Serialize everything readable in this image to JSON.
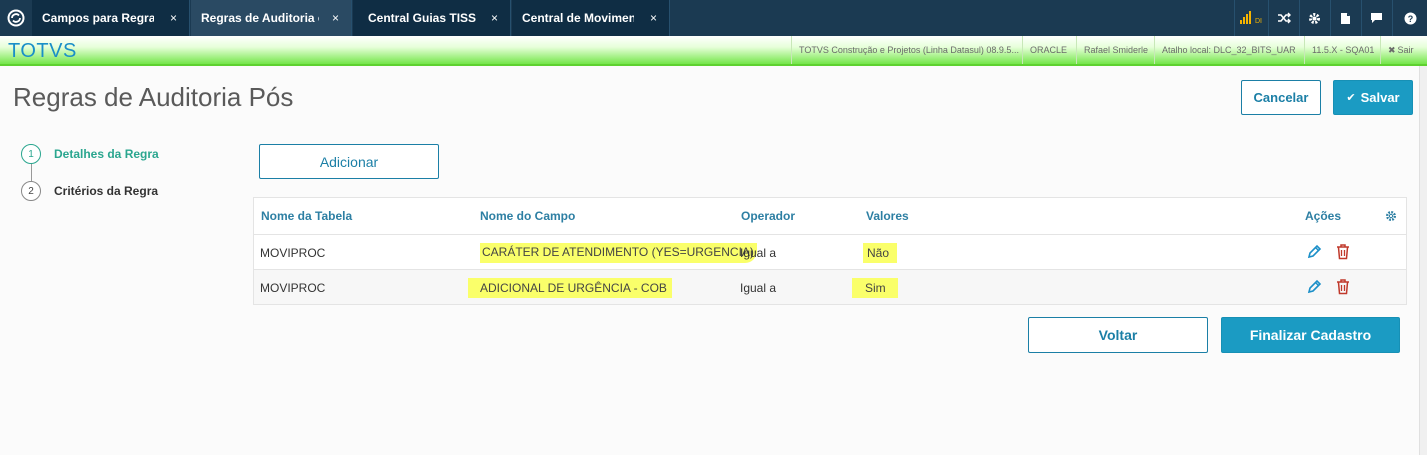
{
  "tabs": [
    {
      "label": "Campos para Regras de Auditoria",
      "close": "×"
    },
    {
      "label": "Regras de Auditoria e Pós",
      "close": "×"
    },
    {
      "label": "Central Guias TISS",
      "close": "×"
    },
    {
      "label": "Central de Movimentação",
      "close": "×"
    }
  ],
  "topbar_icons": [
    {
      "icon": "signal-icon",
      "text": "DI"
    },
    {
      "icon": "shuffle-icon"
    },
    {
      "icon": "gear-icon"
    },
    {
      "icon": "document-icon"
    },
    {
      "icon": "chat-icon"
    },
    {
      "icon": "help-icon"
    }
  ],
  "brand": "TOTVS",
  "info_bar": {
    "company": "TOTVS Construção e Projetos (Linha Datasul) 08.9.5...",
    "database": "ORACLE",
    "user": "Rafael Smiderle",
    "shortcut": "Atalho local: DLC_32_BITS_UAR",
    "version": "11.5.X - SQA01",
    "logout": "Sair"
  },
  "page": {
    "title": "Regras de Auditoria Pós",
    "cancel_label": "Cancelar",
    "save_label": "Salvar",
    "add_label": "Adicionar",
    "back_label": "Voltar",
    "finish_label": "Finalizar Cadastro"
  },
  "steps": [
    {
      "number": "1",
      "label": "Detalhes da Regra"
    },
    {
      "number": "2",
      "label": "Critérios da Regra"
    }
  ],
  "table": {
    "columns": [
      "Nome da Tabela",
      "Nome do Campo",
      "Operador",
      "Valores",
      "Ações"
    ],
    "rows": [
      {
        "tabela": "MOVIPROC",
        "campo": "CARÁTER DE ATENDIMENTO (YES=URGENCIA)",
        "operador": "Igual a",
        "valores": "Não"
      },
      {
        "tabela": "MOVIPROC",
        "campo": "ADICIONAL DE URGÊNCIA - COB",
        "operador": "Igual a",
        "valores": "Sim"
      }
    ]
  },
  "colors": {
    "topbar": "#1b3a52",
    "accent": "#1b9bc3",
    "step_active": "#2aa68f",
    "header_text": "#2d7fa3",
    "delete_icon": "#c0392b",
    "highlight": "#faff6a"
  }
}
